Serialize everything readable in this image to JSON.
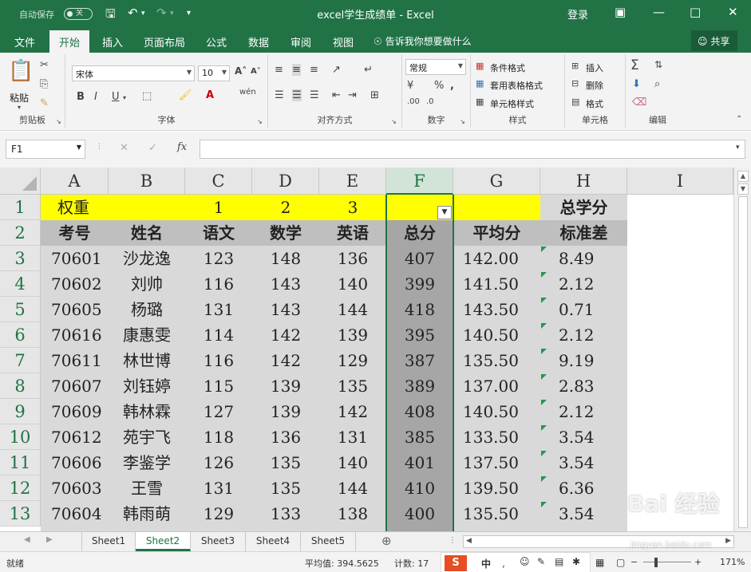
{
  "app": {
    "autosave_label": "自动保存",
    "autosave_state": "关",
    "title": "excel学生成绩单  -  Excel",
    "login": "登录"
  },
  "tabs": [
    "文件",
    "开始",
    "插入",
    "页面布局",
    "公式",
    "数据",
    "审阅",
    "视图"
  ],
  "active_tab": "开始",
  "tell_me": "告诉我你想要做什么",
  "share": "共享",
  "ribbon": {
    "clipboard": {
      "label": "剪贴板",
      "paste": "粘贴"
    },
    "font": {
      "label": "字体",
      "name": "宋体",
      "size": "10",
      "bold": "B",
      "italic": "I",
      "underline": "U",
      "phonetic": "wén"
    },
    "align": {
      "label": "对齐方式"
    },
    "number": {
      "label": "数字",
      "format": "常规"
    },
    "styles": {
      "label": "样式",
      "cond": "条件格式",
      "table": "套用表格格式",
      "cell": "单元格样式"
    },
    "cells": {
      "label": "单元格",
      "insert": "插入",
      "delete": "删除",
      "format": "格式"
    },
    "edit": {
      "label": "编辑"
    }
  },
  "formula_bar": {
    "name_box": "F1",
    "formula": ""
  },
  "columns": [
    "A",
    "B",
    "C",
    "D",
    "E",
    "F",
    "G",
    "H",
    "I"
  ],
  "selected_column": "F",
  "rows": [
    "1",
    "2",
    "3",
    "4",
    "5",
    "6",
    "7",
    "8",
    "9",
    "10",
    "11",
    "12",
    "13"
  ],
  "row1": {
    "a": "权重",
    "c": "1",
    "d": "2",
    "e": "3",
    "h": "总学分"
  },
  "row2": {
    "a": "考号",
    "b": "姓名",
    "c": "语文",
    "d": "数学",
    "e": "英语",
    "f": "总分",
    "g": "平均分",
    "h": "标准差"
  },
  "records": [
    {
      "id": "70601",
      "name": "沙龙逸",
      "yw": "123",
      "sx": "148",
      "yy": "136",
      "total": "407",
      "avg": "142.00",
      "std": "8.49"
    },
    {
      "id": "70602",
      "name": "刘帅",
      "yw": "116",
      "sx": "143",
      "yy": "140",
      "total": "399",
      "avg": "141.50",
      "std": "2.12"
    },
    {
      "id": "70605",
      "name": "杨璐",
      "yw": "131",
      "sx": "143",
      "yy": "144",
      "total": "418",
      "avg": "143.50",
      "std": "0.71"
    },
    {
      "id": "70616",
      "name": "康惠雯",
      "yw": "114",
      "sx": "142",
      "yy": "139",
      "total": "395",
      "avg": "140.50",
      "std": "2.12"
    },
    {
      "id": "70611",
      "name": "林世博",
      "yw": "116",
      "sx": "142",
      "yy": "129",
      "total": "387",
      "avg": "135.50",
      "std": "9.19"
    },
    {
      "id": "70607",
      "name": "刘钰婷",
      "yw": "115",
      "sx": "139",
      "yy": "135",
      "total": "389",
      "avg": "137.00",
      "std": "2.83"
    },
    {
      "id": "70609",
      "name": "韩林霖",
      "yw": "127",
      "sx": "139",
      "yy": "142",
      "total": "408",
      "avg": "140.50",
      "std": "2.12"
    },
    {
      "id": "70612",
      "name": "苑宇飞",
      "yw": "118",
      "sx": "136",
      "yy": "131",
      "total": "385",
      "avg": "133.50",
      "std": "3.54"
    },
    {
      "id": "70606",
      "name": "李鉴学",
      "yw": "126",
      "sx": "135",
      "yy": "140",
      "total": "401",
      "avg": "137.50",
      "std": "3.54"
    },
    {
      "id": "70603",
      "name": "王雪",
      "yw": "131",
      "sx": "135",
      "yy": "144",
      "total": "410",
      "avg": "139.50",
      "std": "6.36"
    },
    {
      "id": "70604",
      "name": "韩雨萌",
      "yw": "129",
      "sx": "133",
      "yy": "138",
      "total": "400",
      "avg": "135.50",
      "std": "3.54"
    }
  ],
  "sheets": [
    "Sheet1",
    "Sheet2",
    "Sheet3",
    "Sheet4",
    "Sheet5"
  ],
  "active_sheet": "Sheet2",
  "status": {
    "ready": "就绪",
    "average": "平均值: 394.5625",
    "count": "计数: 17",
    "ime": "中",
    "zoom": "171%"
  },
  "watermark": {
    "text": "Bai 经验",
    "sub": "jingyan.baidu.com"
  },
  "colors": {
    "excel_green": "#217346",
    "header_yellow": "#ffff00",
    "selection_gray": "#a6a6a6",
    "data_gray": "#d9d9d9"
  }
}
